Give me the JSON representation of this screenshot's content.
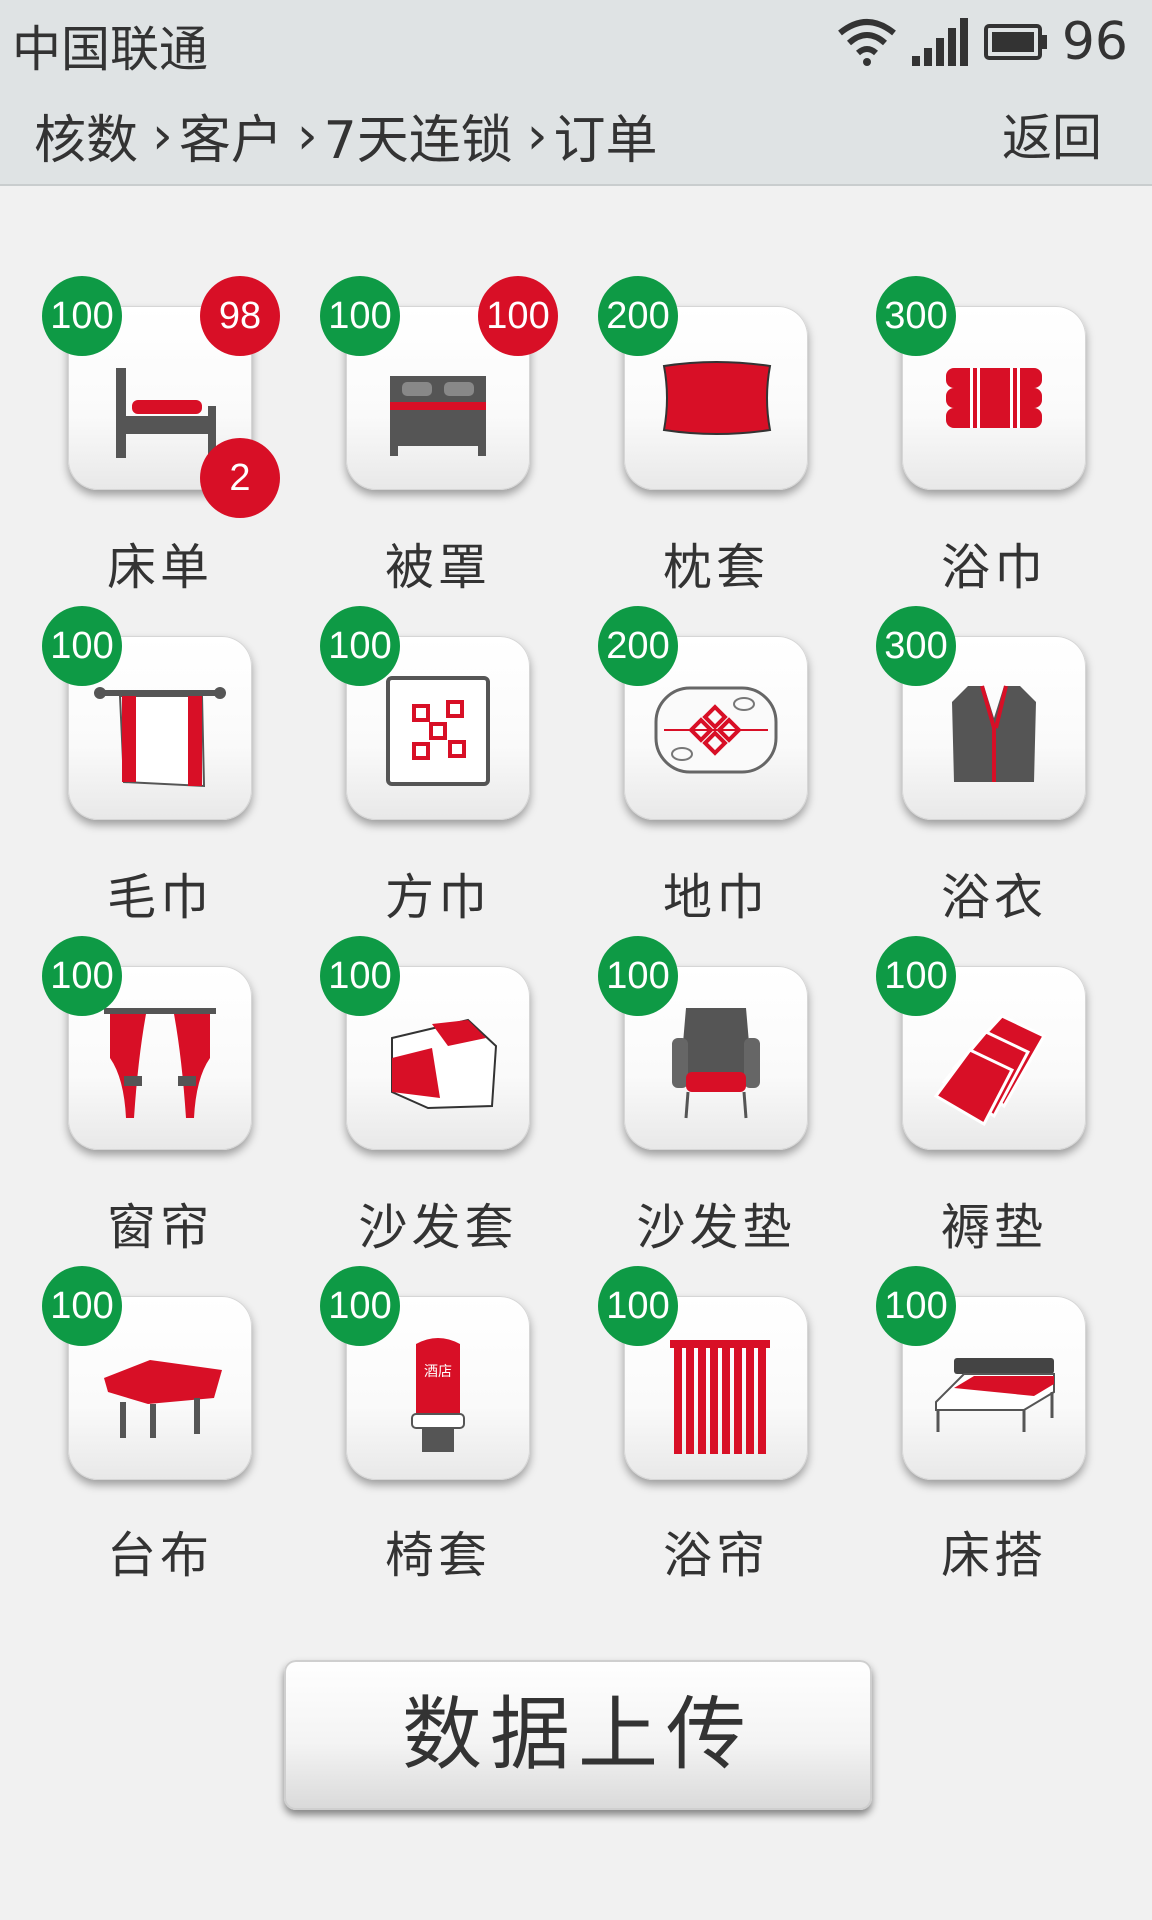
{
  "status": {
    "carrier": "中国联通",
    "battery": "96"
  },
  "header": {
    "breadcrumb": [
      "核数",
      "客户",
      "7天连锁",
      "订单"
    ],
    "back_label": "返回"
  },
  "items": [
    {
      "label": "床单",
      "icon": "bed-sheet-icon",
      "count": "100",
      "red_top": "98",
      "red_bottom": "2"
    },
    {
      "label": "被罩",
      "icon": "duvet-cover-icon",
      "count": "100",
      "red_top": "100"
    },
    {
      "label": "枕套",
      "icon": "pillowcase-icon",
      "count": "200"
    },
    {
      "label": "浴巾",
      "icon": "bath-towel-icon",
      "count": "300"
    },
    {
      "label": "毛巾",
      "icon": "hand-towel-icon",
      "count": "100"
    },
    {
      "label": "方巾",
      "icon": "face-cloth-icon",
      "count": "100"
    },
    {
      "label": "地巾",
      "icon": "floor-mat-icon",
      "count": "200"
    },
    {
      "label": "浴衣",
      "icon": "bathrobe-icon",
      "count": "300"
    },
    {
      "label": "窗帘",
      "icon": "curtain-icon",
      "count": "100"
    },
    {
      "label": "沙发套",
      "icon": "sofa-cover-icon",
      "count": "100"
    },
    {
      "label": "沙发垫",
      "icon": "sofa-cushion-icon",
      "count": "100"
    },
    {
      "label": "褥垫",
      "icon": "mattress-pad-icon",
      "count": "100"
    },
    {
      "label": "台布",
      "icon": "tablecloth-icon",
      "count": "100"
    },
    {
      "label": "椅套",
      "icon": "chair-cover-icon",
      "count": "100"
    },
    {
      "label": "浴帘",
      "icon": "shower-curtain-icon",
      "count": "100"
    },
    {
      "label": "床搭",
      "icon": "bed-runner-icon",
      "count": "100"
    }
  ],
  "chair_text": "酒店",
  "upload_label": "数据上传",
  "colors": {
    "accent_red": "#d80f26",
    "badge_green": "#0e9a45",
    "icon_gray": "#555555"
  }
}
